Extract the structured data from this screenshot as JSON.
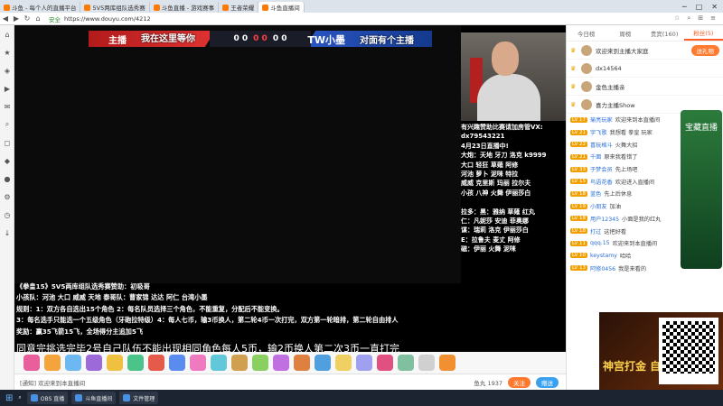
{
  "browser": {
    "tabs": [
      {
        "label": "斗鱼 - 每个人的直播平台",
        "active": false
      },
      {
        "label": "5V5两库组队选秀赛",
        "active": false
      },
      {
        "label": "斗鱼直播 - 游戏赛事",
        "active": false
      },
      {
        "label": "王者荣耀",
        "active": false
      },
      {
        "label": "斗鱼直播间",
        "active": true
      }
    ],
    "window_buttons": [
      "─",
      "□",
      "✕"
    ],
    "url_secure": "安全",
    "url": "https://www.douyu.com/4212"
  },
  "sidebar": {
    "icons": [
      "home-icon",
      "star-icon",
      "game-icon",
      "video-icon",
      "mail-icon",
      "search-icon",
      "message-icon",
      "gift-icon",
      "user-icon",
      "settings-icon",
      "history-icon",
      "download-icon"
    ]
  },
  "video": {
    "team_left": "主播",
    "slogan_left": "我在这里等你",
    "score_left": "0 0",
    "score_mid": "0 0",
    "score_right": "0 0",
    "team_right": "TW小墨",
    "slogan_right": "对面有个主播",
    "info_lines": [
      "有兴趣赞助比赛请加房管VX:",
      "dx79543221",
      "4月23日直播中!",
      "大炮：天地 牙刀 洛克 k9999",
      "大口 轻狂 草薙 阿修",
      "河池 萝卜 泥咪 特拉",
      "威威 克里斯 玛丽 拉尔夫",
      "小孩 八神 火舞 伊丽莎白",
      "",
      "拉多：黑：雅纳 草薙 红丸",
      "仁：凡妮莎 安迪 菲奥娜",
      "谋：瑞莉 洛克 伊丽莎白",
      "E：拉鲁夫 麦丈 阿修",
      "磁：伊丽 火舞 泥咪"
    ],
    "rule_lines": [
      "《拳皇15》5V5两库组队选秀赛赞助：初吸哥",
      "小孩队：河池 大口 威威 天地      泰哥队：曹家锦 达达 阿仁 台湾小墨",
      "规则：1：双方各自选出15个角色 2：每名队员选择三个角色，不能重复，分配后不能变换。",
      "3：每名选手只能选一个五级角色（牙砲拉特级）4：每人七币，输3币换人，第二轮4币一次打完，双方第一轮暗排，第二轮自由排人",
      "奖励：赢35飞箭15飞，全场得分主追加5飞"
    ],
    "scroll_text": "同意完挑选完毕2号自己队伍不能出现相同角色每人5币，输2币换人第二次3币一直打完"
  },
  "gifts": [
    "#e85f9c",
    "#f3a43c",
    "#6db8f0",
    "#9c6bd9",
    "#f0c040",
    "#4bc48a",
    "#e65a4b",
    "#5a8cf0",
    "#f07ac0",
    "#60c8d8",
    "#d0a050",
    "#8ad060",
    "#c070e0",
    "#e08040",
    "#50a0e0",
    "#f0d060",
    "#a0a0f0",
    "#e05080",
    "#80c0a0",
    "#d0d0d0",
    "#f09030"
  ],
  "bottom": {
    "left_text": "[通知] 欢迎来到本直播间",
    "count_text": "鱼丸 1937",
    "follow_label": "关注",
    "send_label": "赠送"
  },
  "chat": {
    "tabs": [
      {
        "label": "今日榜",
        "active": false
      },
      {
        "label": "周榜",
        "active": false
      },
      {
        "label": "贵宾(160)",
        "active": false
      },
      {
        "label": "粉丝(5)",
        "active": true
      }
    ],
    "rank": [
      {
        "name": "欢迎来到主播大家庭",
        "badge": "送礼物"
      },
      {
        "name": "dx14564",
        "badge": ""
      },
      {
        "name": "金色主播亲",
        "badge": ""
      },
      {
        "name": "喜力主播Show",
        "badge": ""
      }
    ],
    "messages": [
      {
        "lv": "LV 17",
        "user": "瑜亮玩家",
        "text": "欢迎来到本直播间"
      },
      {
        "lv": "LV 21",
        "user": "宇飞歌",
        "text": "我想看 拳皇 玩家"
      },
      {
        "lv": "LV 22",
        "user": "喜玩格斗",
        "text": "火舞大招"
      },
      {
        "lv": "LV 21",
        "user": "千面",
        "text": "原来我看错了"
      },
      {
        "lv": "LV 33",
        "user": "于梦会员",
        "text": "先上场吧"
      },
      {
        "lv": "LV 15",
        "user": "鸟语花香",
        "text": "欢迎进入直播间"
      },
      {
        "lv": "LV 18",
        "user": "蓝色",
        "text": "先上后休息"
      },
      {
        "lv": "LV 19",
        "user": "小朋友",
        "text": "加油"
      },
      {
        "lv": "LV 18",
        "user": "用户12345",
        "text": "小面是我的红丸"
      },
      {
        "lv": "LV 18",
        "user": "打过",
        "text": "这把好看"
      },
      {
        "lv": "LV 11",
        "user": "qqq.15",
        "text": "欢迎来到本直播间"
      },
      {
        "lv": "LV 10",
        "user": "keystamy",
        "text": "哈哈"
      },
      {
        "lv": "LV 13",
        "user": "阿修0456",
        "text": "我是来看的"
      }
    ],
    "promo_text": "宝藏直播",
    "ad_title": "神宫打金 自由交易"
  },
  "taskbar": [
    {
      "label": "OBS 直播"
    },
    {
      "label": "斗鱼直播间"
    },
    {
      "label": "文件管理"
    }
  ]
}
